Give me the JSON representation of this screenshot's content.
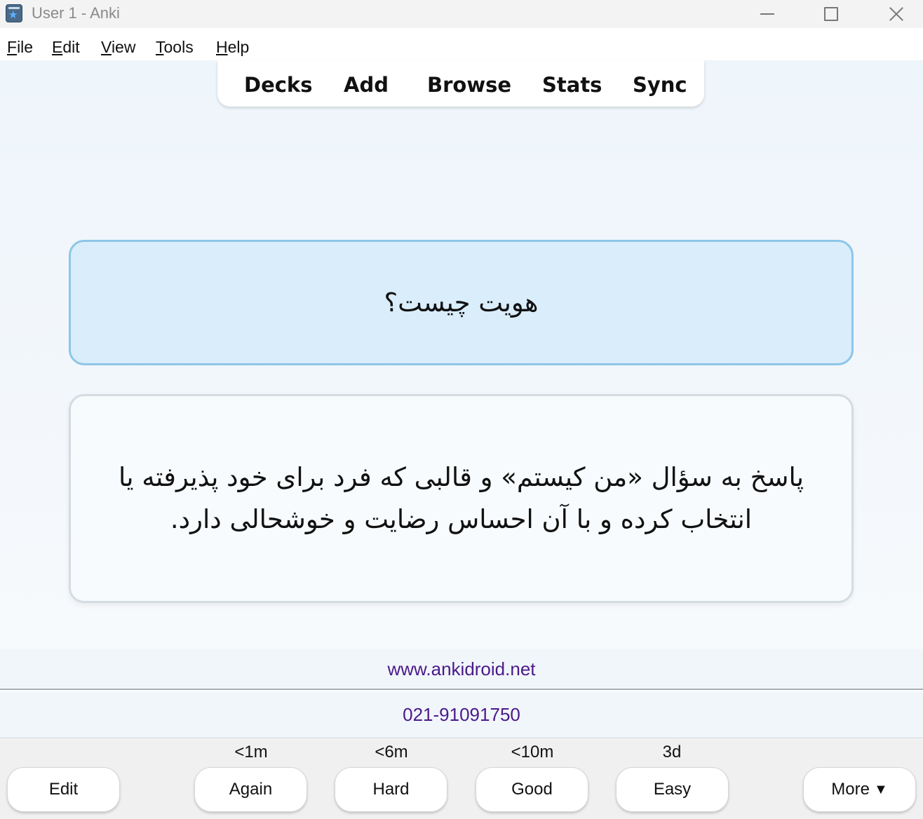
{
  "window": {
    "title": "User 1 - Anki"
  },
  "menu": {
    "items": [
      {
        "label_u": "F",
        "label_rest": "ile"
      },
      {
        "label_u": "E",
        "label_rest": "dit"
      },
      {
        "label_u": "V",
        "label_rest": "iew"
      },
      {
        "label_u": "T",
        "label_rest": "ools"
      },
      {
        "label_u": "H",
        "label_rest": "elp"
      }
    ]
  },
  "toolbar": {
    "decks": "Decks",
    "add": "Add",
    "browse": "Browse",
    "stats": "Stats",
    "sync": "Sync"
  },
  "card": {
    "question": "هویت چیست؟",
    "answer": "پاسخ به سؤال «من کیستم» و قالبی که فرد برای خود پذیرفته یا انتخاب کرده و با آن احساس رضایت و خوشحالی دارد."
  },
  "footer": {
    "website": "www.ankidroid.net",
    "phone": "021-91091750"
  },
  "review": {
    "edit": "Edit",
    "again": "Again",
    "again_interval": "<1m",
    "hard": "Hard",
    "hard_interval": "<6m",
    "good": "Good",
    "good_interval": "<10m",
    "easy": "Easy",
    "easy_interval": "3d",
    "more": "More",
    "more_caret": "▼"
  }
}
